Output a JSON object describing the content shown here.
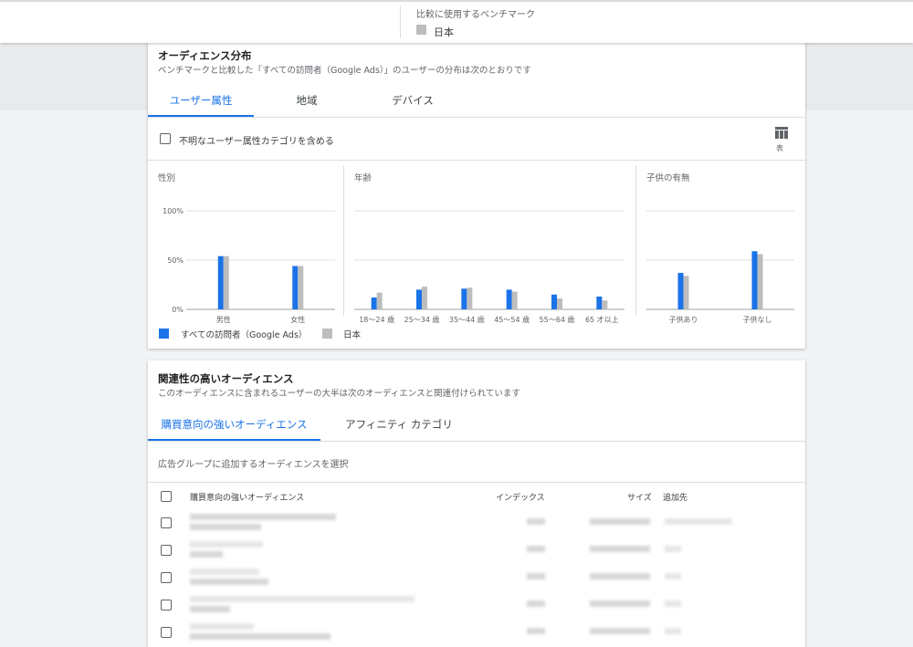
{
  "benchmark": {
    "label": "比較に使用するベンチマーク",
    "value": "日本"
  },
  "audience_distribution": {
    "title": "オーディエンス分布",
    "subtitle": "ベンチマークと比較した「すべての訪問者（Google Ads）」のユーザーの分布は次のとおりです",
    "tabs": [
      "ユーザー属性",
      "地域",
      "デバイス"
    ],
    "active_tab": 0,
    "include_unknown_label": "不明なユーザー属性カテゴリを含める",
    "table_button_label": "表",
    "legend": {
      "series1": "すべての訪問者（Google Ads）",
      "series2": "日本"
    },
    "colors": {
      "series1": "#1a73e8",
      "series2": "#bdbdbd"
    }
  },
  "chart_data": [
    {
      "type": "bar",
      "title": "性別",
      "categories": [
        "男性",
        "女性"
      ],
      "series": [
        {
          "name": "すべての訪問者（Google Ads）",
          "values": [
            54,
            44
          ]
        },
        {
          "name": "日本",
          "values": [
            54,
            44
          ]
        }
      ],
      "ylim": [
        0,
        100
      ],
      "yticks": [
        "0%",
        "50%",
        "100%"
      ],
      "grid": true
    },
    {
      "type": "bar",
      "title": "年齢",
      "categories": [
        "18～24 歳",
        "25～34 歳",
        "35～44 歳",
        "45～54 歳",
        "55～64 歳",
        "65 才以上"
      ],
      "series": [
        {
          "name": "すべての訪問者（Google Ads）",
          "values": [
            12,
            20,
            21,
            20,
            15,
            13
          ]
        },
        {
          "name": "日本",
          "values": [
            17,
            23,
            22,
            18,
            11,
            9
          ]
        }
      ],
      "ylim": [
        0,
        100
      ],
      "grid": true
    },
    {
      "type": "bar",
      "title": "子供の有無",
      "categories": [
        "子供あり",
        "子供なし"
      ],
      "series": [
        {
          "name": "すべての訪問者（Google Ads）",
          "values": [
            37,
            59
          ]
        },
        {
          "name": "日本",
          "values": [
            34,
            56
          ]
        }
      ],
      "ylim": [
        0,
        100
      ],
      "grid": true
    }
  ],
  "related_audiences": {
    "title": "関連性の高いオーディエンス",
    "subtitle": "このオーディエンスに含まれるユーザーの大半は次のオーディエンスと関連付けられています",
    "tabs": [
      "購買意向の強いオーディエンス",
      "アフィニティ カテゴリ"
    ],
    "active_tab": 0,
    "select_label": "広告グループに追加するオーディエンスを選択",
    "columns": [
      "購買意向の強いオーディエンス",
      "インデックス",
      "サイズ",
      "追加先"
    ]
  }
}
